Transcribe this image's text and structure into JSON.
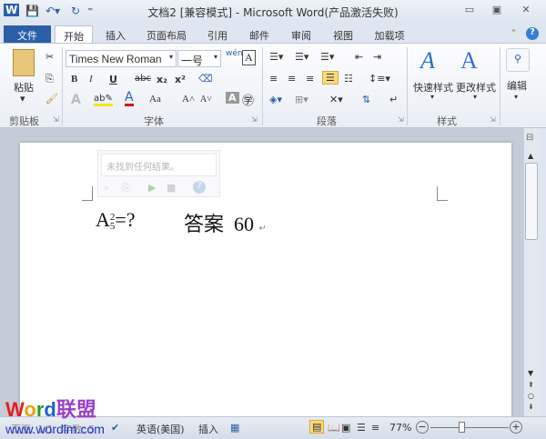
{
  "titlebar": {
    "title": "文档2 [兼容模式] - Microsoft Word(产品激活失败)",
    "app_icon": "W",
    "minimize": "▭",
    "restore": "▣",
    "close": "✕"
  },
  "tabs": [
    "文件",
    "开始",
    "插入",
    "页面布局",
    "引用",
    "邮件",
    "审阅",
    "视图",
    "加载项"
  ],
  "ribbon": {
    "clipboard": {
      "paste": "粘贴",
      "label": "剪贴板"
    },
    "font": {
      "name": "Times New Roman",
      "size": "一号",
      "label": "字体",
      "bold": "B",
      "italic": "I",
      "underline": "U",
      "strike": "abc",
      "sub": "x₂",
      "sup": "x²",
      "grow": "A˄",
      "shrink": "A˅",
      "case": "Aa",
      "phonetic": "wén",
      "border_a": "A"
    },
    "paragraph": {
      "label": "段落"
    },
    "styles": {
      "quick": "快速样式",
      "change": "更改样式",
      "label": "样式"
    },
    "editing": {
      "label": "编辑"
    }
  },
  "find_panel": {
    "message": "未找到任何结果。"
  },
  "document": {
    "base": "A",
    "sup": "2",
    "sub": "5",
    "rest": "=?",
    "answer_label": "答案",
    "answer_value": "60",
    "para_mark": "↵"
  },
  "status": {
    "page": "页面: 1/1",
    "words": "字数: 5",
    "language": "英语(美国)",
    "mode": "插入",
    "zoom": "77%",
    "zoom_percent": 77
  },
  "watermark": {
    "brand": "Word联盟",
    "url": "www.wordlm.com"
  }
}
